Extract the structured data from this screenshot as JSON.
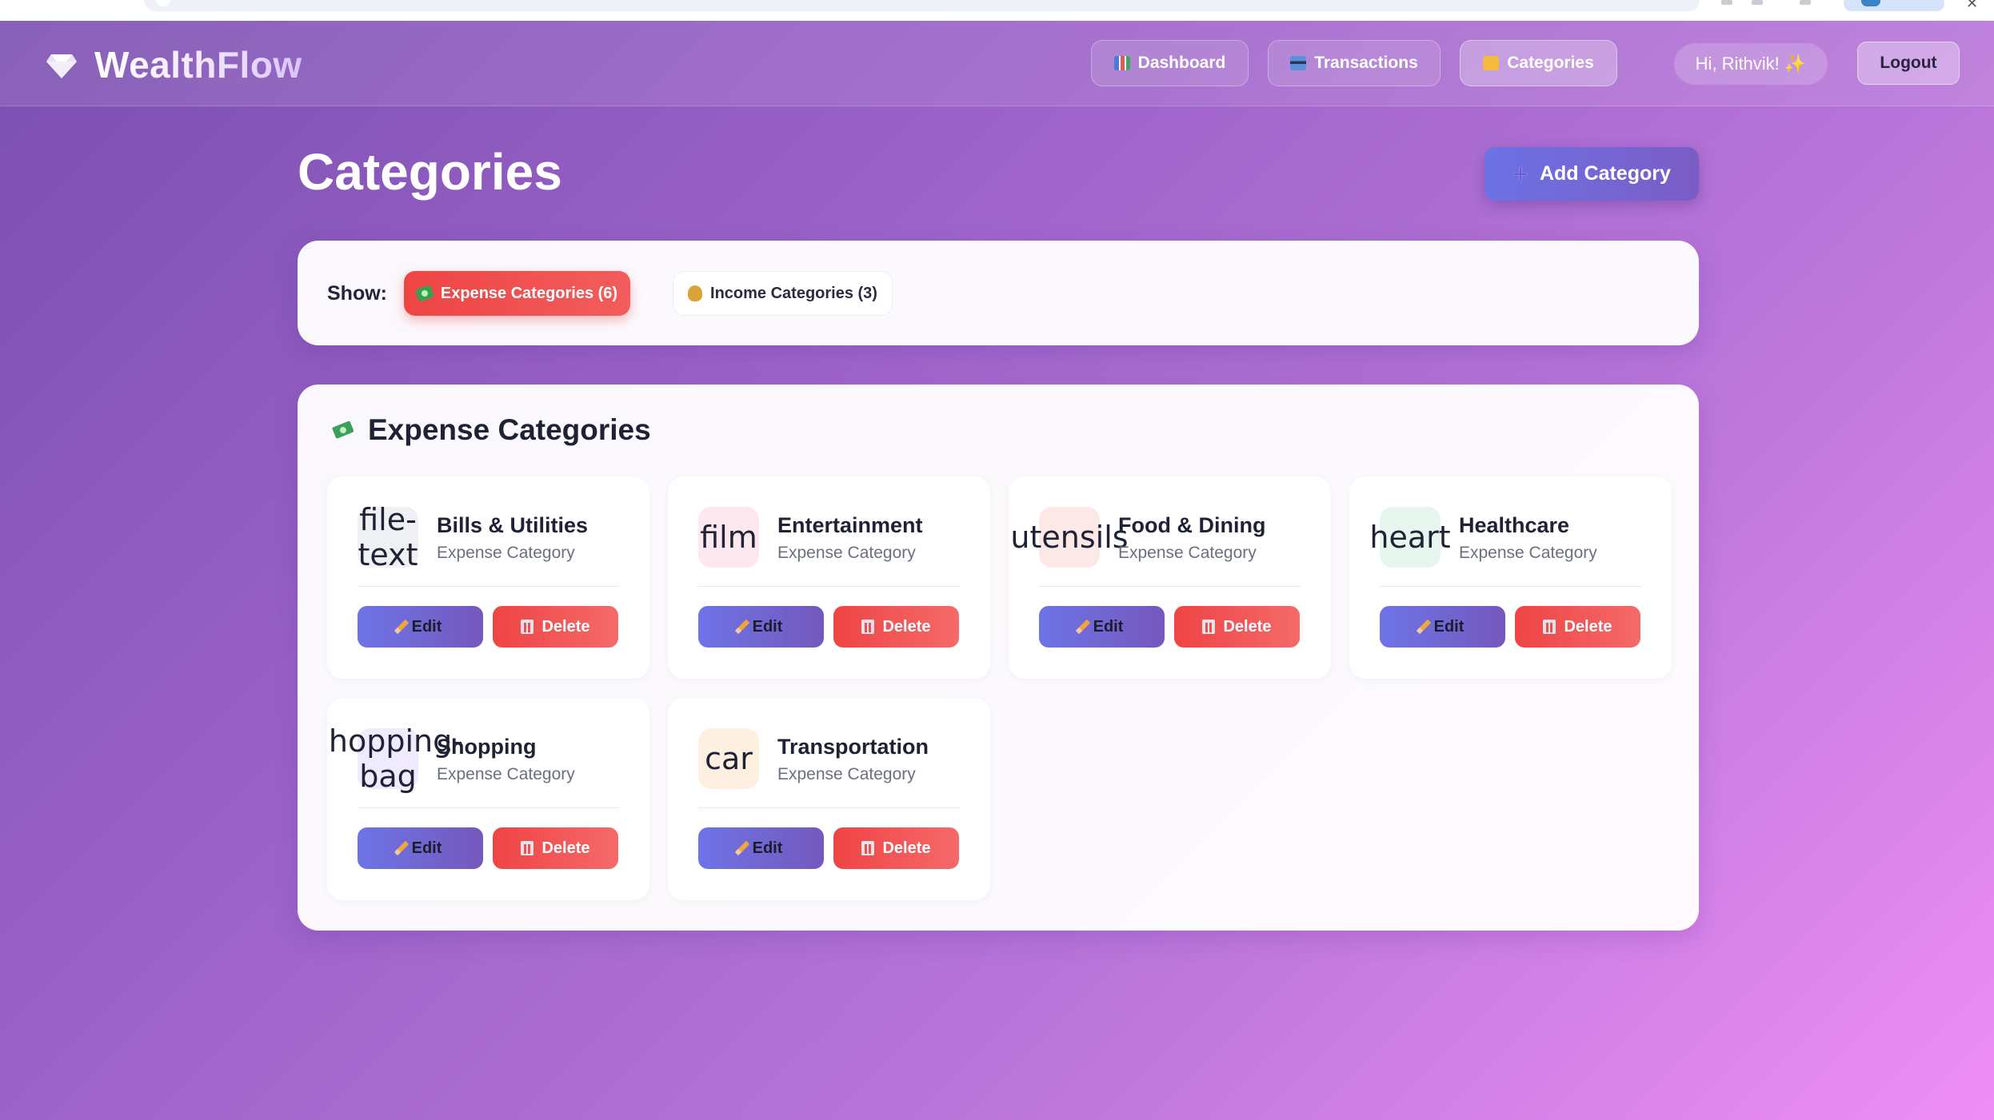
{
  "app": {
    "name": "WealthFlow"
  },
  "nav": {
    "dashboard": {
      "label": "Dashboard",
      "icon": "bar-chart-icon"
    },
    "transactions": {
      "label": "Transactions",
      "icon": "credit-card-icon"
    },
    "categories": {
      "label": "Categories",
      "icon": "folder-icon",
      "active": true
    },
    "greeting": "Hi, Rithvik! ✨",
    "logout": "Logout"
  },
  "page": {
    "title": "Categories",
    "add_button": "Add Category"
  },
  "filter": {
    "label": "Show:",
    "expense": "Expense Categories (6)",
    "income": "Income Categories (3)",
    "selected": "expense"
  },
  "section": {
    "title": "Expense Categories",
    "icon": "money-with-wings-icon"
  },
  "categories": [
    {
      "name": "Bills & Utilities",
      "type": "Expense Category",
      "icon": "file-text",
      "tint": "#eef0f4"
    },
    {
      "name": "Entertainment",
      "type": "Expense Category",
      "icon": "film",
      "tint": "#fde8ef"
    },
    {
      "name": "Food & Dining",
      "type": "Expense Category",
      "icon": "utensils",
      "tint": "#fde8e8"
    },
    {
      "name": "Healthcare",
      "type": "Expense Category",
      "icon": "heart",
      "tint": "#e6f6ef"
    },
    {
      "name": "Shopping",
      "type": "Expense Category",
      "icon": "shopping-bag",
      "tint": "#efeafd"
    },
    {
      "name": "Transportation",
      "type": "Expense Category",
      "icon": "car",
      "tint": "#fdf0e1"
    }
  ],
  "actions": {
    "edit": "Edit",
    "delete": "Delete"
  },
  "colors": {
    "expense": "#ef4444",
    "primary": "#6c72e6",
    "accent": "#7b5cc4"
  }
}
